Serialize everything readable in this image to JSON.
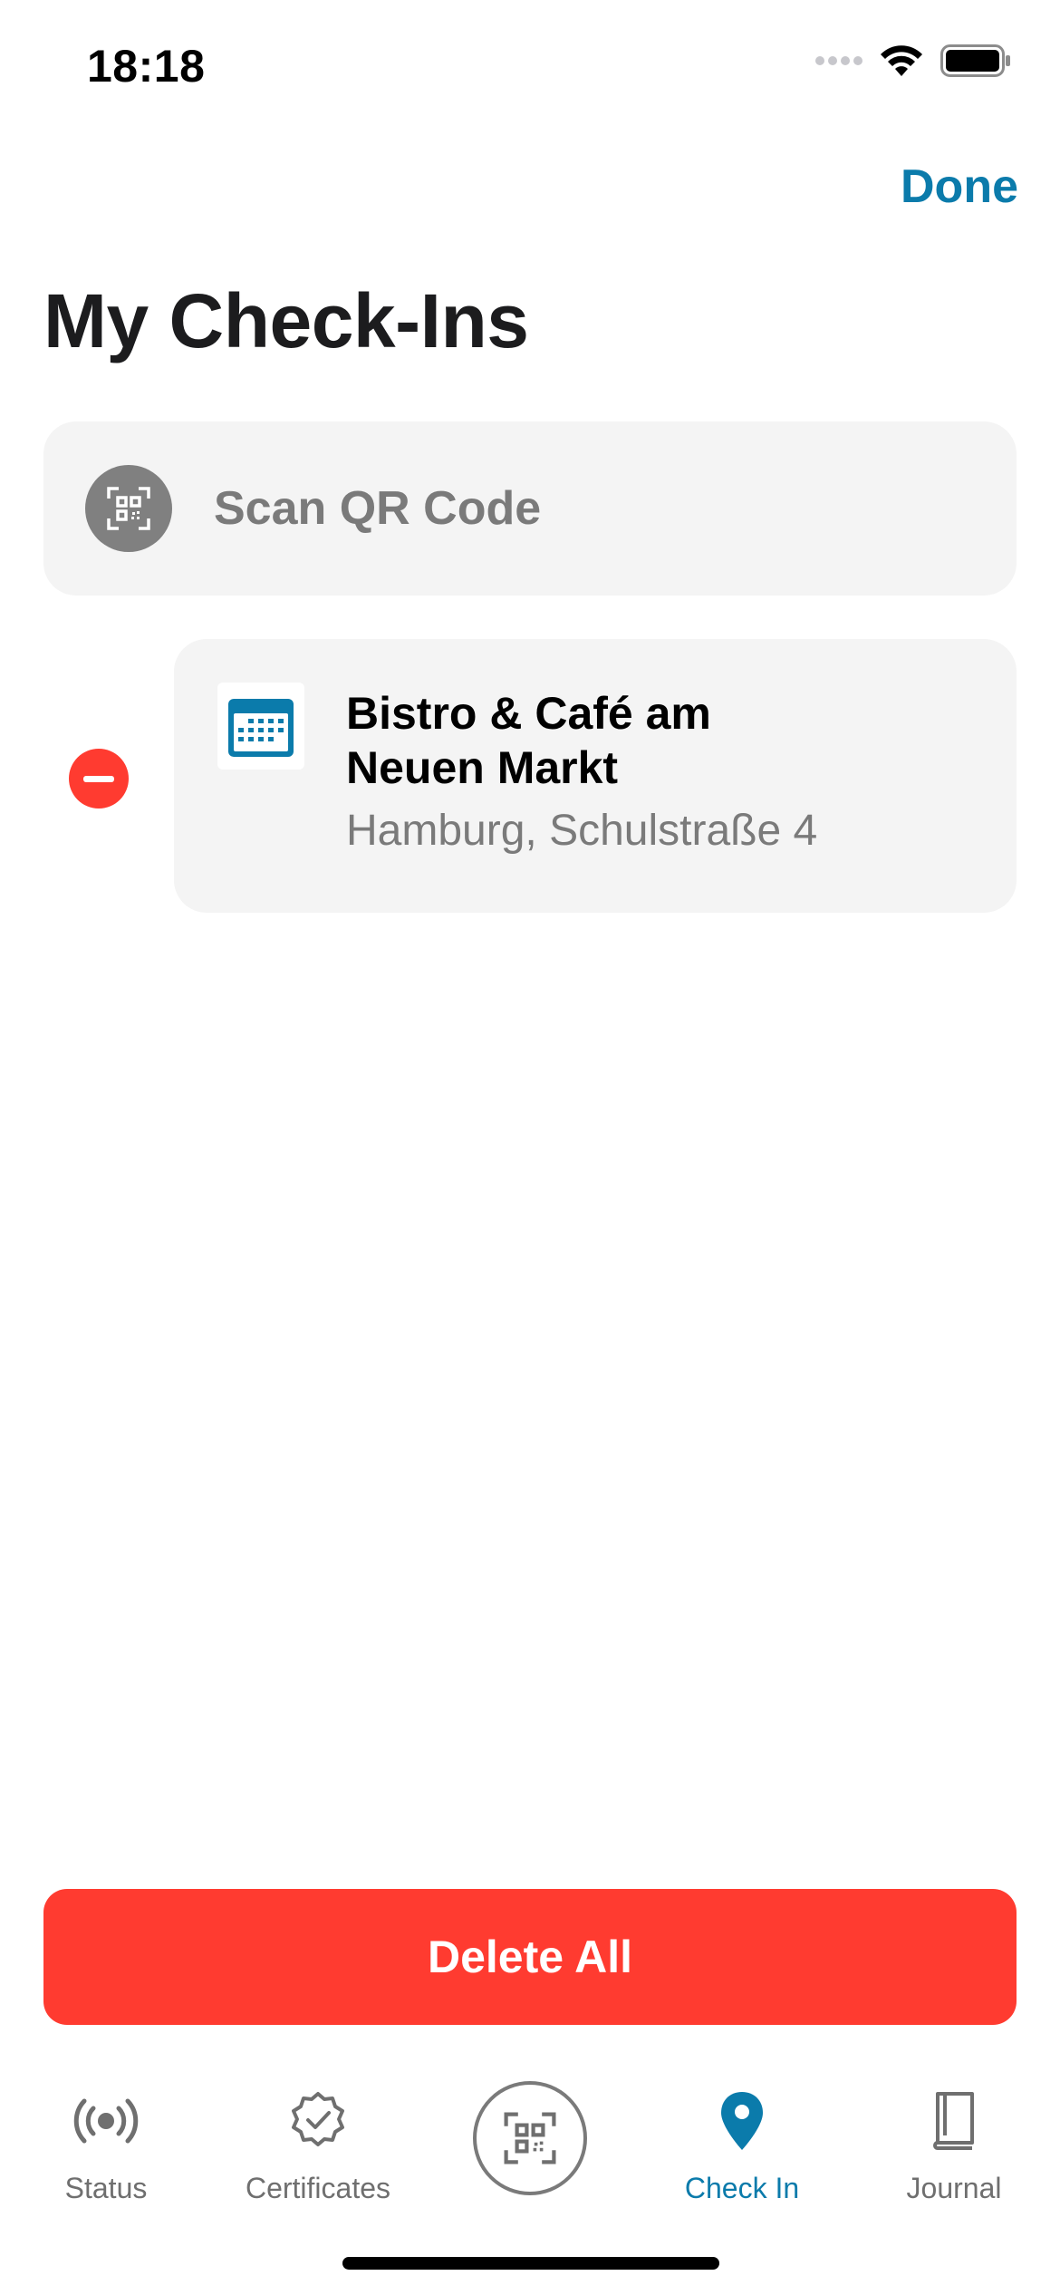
{
  "status_bar": {
    "time": "18:18"
  },
  "nav": {
    "done_label": "Done"
  },
  "page": {
    "title": "My Check-Ins"
  },
  "scan": {
    "label": "Scan QR Code",
    "icon": "qr-scan-icon"
  },
  "checkins": [
    {
      "title_line1": "Bistro & Café am",
      "title_line2": "Neuen Markt",
      "address": "Hamburg, Schulstraße 4",
      "icon": "calendar-icon"
    }
  ],
  "actions": {
    "delete_all_label": "Delete All"
  },
  "tabs": [
    {
      "label": "Status",
      "icon": "broadcast-icon",
      "active": false
    },
    {
      "label": "Certificates",
      "icon": "certificate-icon",
      "active": false
    },
    {
      "label": "",
      "icon": "qr-scan-icon",
      "active": false
    },
    {
      "label": "Check In",
      "icon": "location-pin-icon",
      "active": true
    },
    {
      "label": "Journal",
      "icon": "journal-book-icon",
      "active": false
    }
  ],
  "colors": {
    "accent": "#0b7bab",
    "destructive": "#ff3b30",
    "card_background": "#f4f4f4",
    "secondary_text": "#7a7a7a"
  }
}
